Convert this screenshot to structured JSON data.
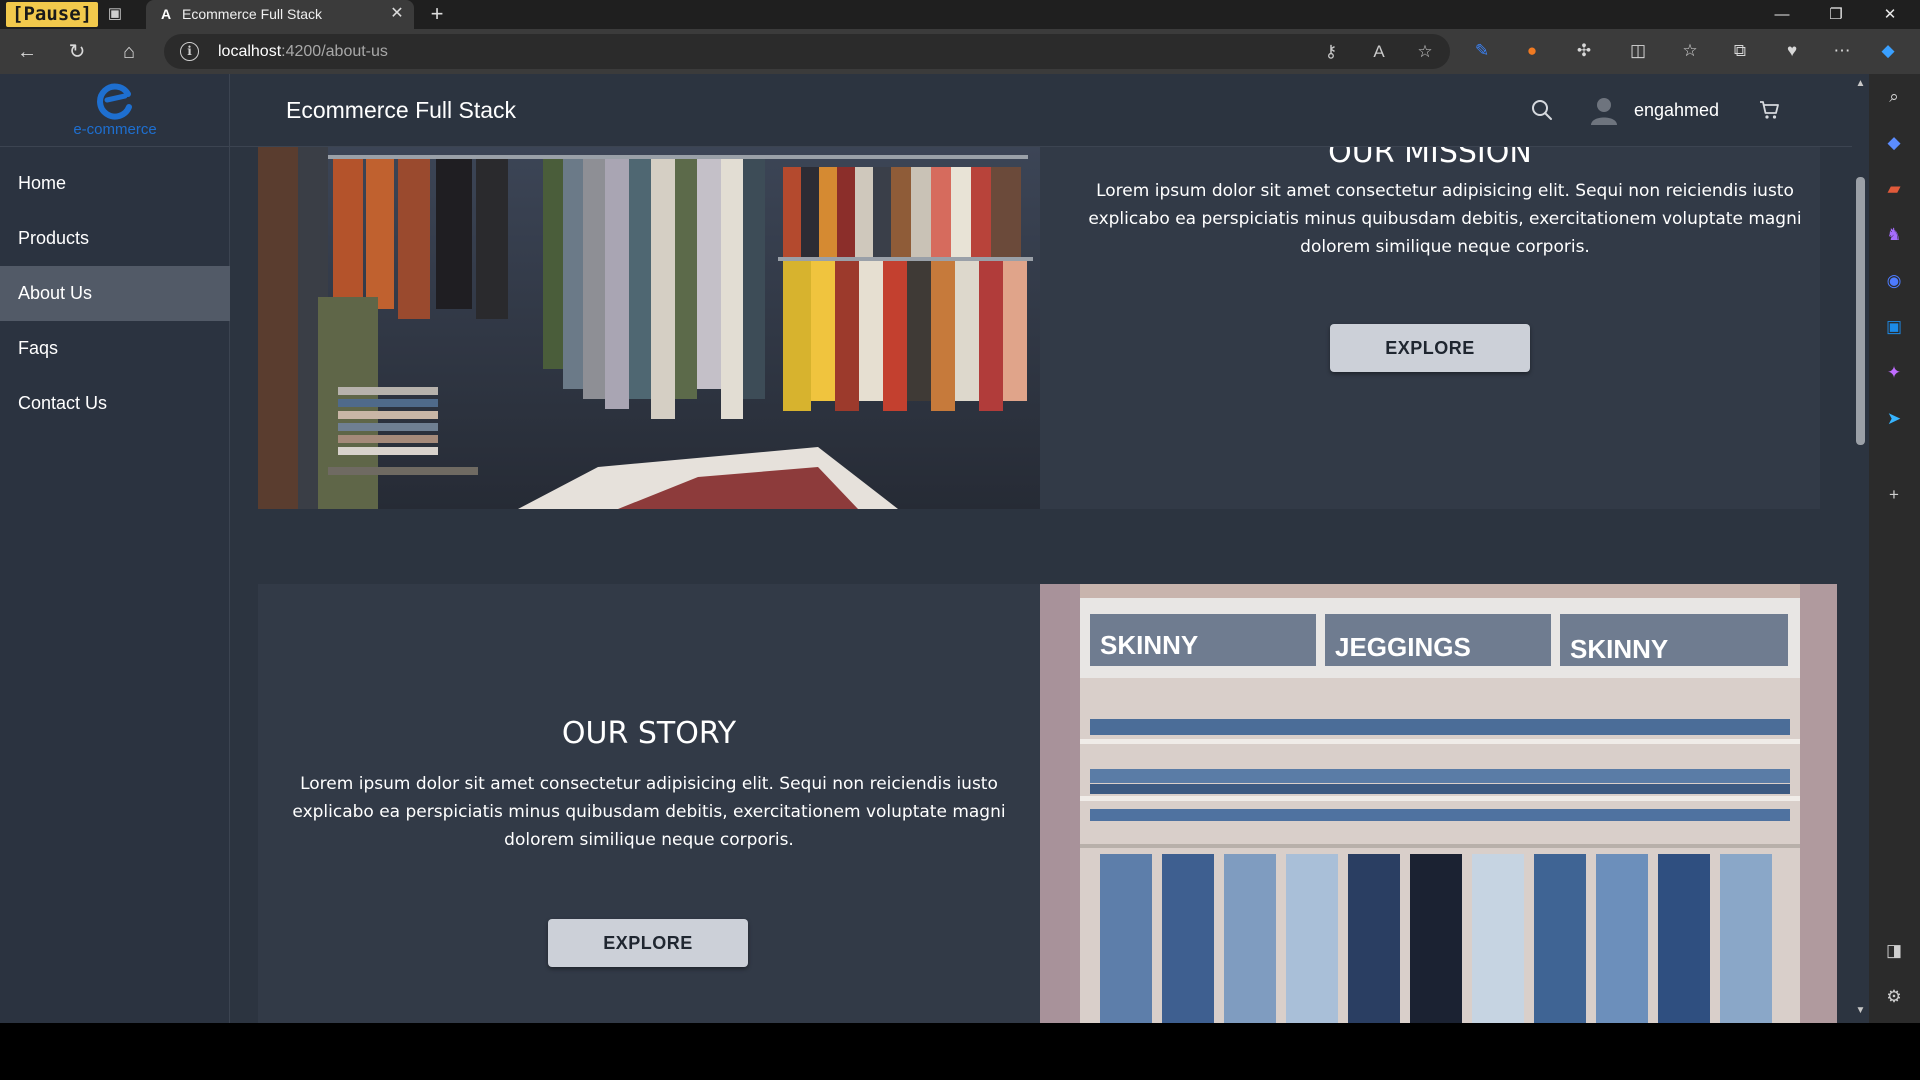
{
  "browser": {
    "recording_badge": "[Pause]",
    "tab_title": "Ecommerce Full Stack",
    "url_host": "localhost",
    "url_path": ":4200/about-us"
  },
  "app": {
    "brand": "Ecommerce Full Stack",
    "logo_text": "e-commerce",
    "username": "engahmed",
    "accent_color": "#1e6fd0"
  },
  "sidebar": {
    "items": [
      {
        "label": "Home"
      },
      {
        "label": "Products"
      },
      {
        "label": "About Us"
      },
      {
        "label": "Faqs"
      },
      {
        "label": "Contact Us"
      }
    ],
    "active": "About Us"
  },
  "mission": {
    "title": "OUR MISSION",
    "text": "Lorem ipsum dolor sit amet consectetur adipisicing elit. Sequi non reiciendis iusto explicabo ea perspiciatis minus quibusdam debitis, exercitationem voluptate magni dolorem similique neque corporis.",
    "button": "EXPLORE"
  },
  "story": {
    "title": "OUR STORY",
    "text": "Lorem ipsum dolor sit amet consectetur adipisicing elit. Sequi non reiciendis iusto explicabo ea perspiciatis minus quibusdam debitis, exercitationem voluptate magni dolorem similique neque corporis.",
    "button": "EXPLORE",
    "image_signs": [
      "SKINNY",
      "JEGGINGS",
      "SKINNY"
    ]
  }
}
